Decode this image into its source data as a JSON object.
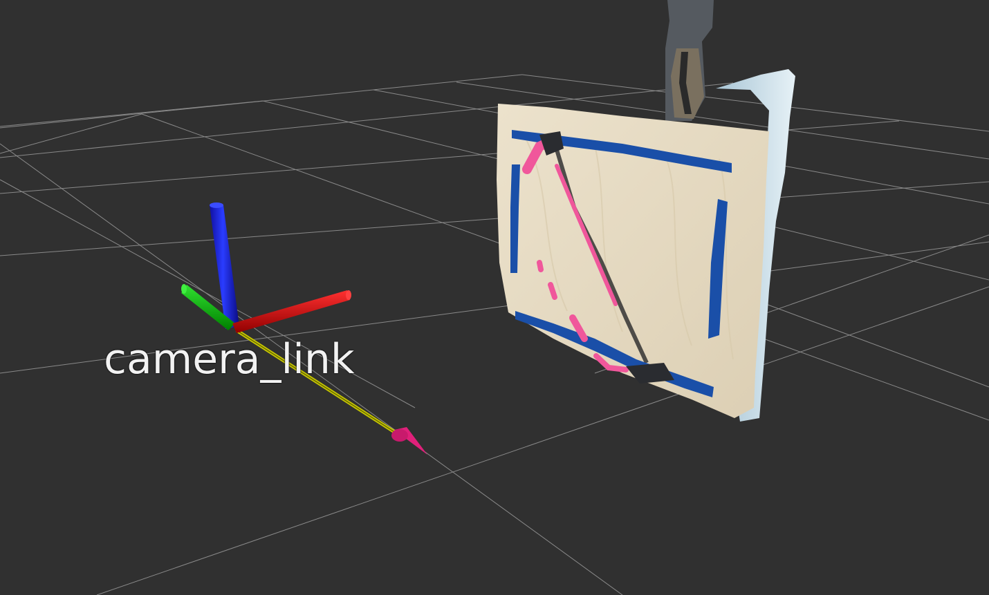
{
  "app": {
    "view": "3D Viewport"
  },
  "viewport": {
    "background_color": "#303030",
    "grid_color": "#a0a0a0",
    "frames": [
      {
        "name": "camera_link",
        "axes": {
          "x_color": "#e00000",
          "y_color": "#00c000",
          "z_color": "#0010e0"
        }
      }
    ],
    "arrow": {
      "shaft_color": "#c8c800",
      "head_color": "#e0207a"
    },
    "point_cloud": {
      "board_color": "#e8dcc4",
      "tape_color": "#1a4fa8",
      "line_color": "#f0579b",
      "edge_color": "#cfe3ec"
    }
  }
}
